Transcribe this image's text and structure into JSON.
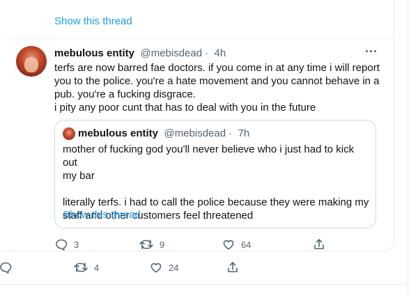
{
  "top_thread_link": "Show this thread",
  "tweet": {
    "name": "mebulous entity",
    "handle": "@mebisdead",
    "dot": "·",
    "time": "4h",
    "text": "terfs are now barred fae doctors. if you come in at any time i will report\nyou to the police. you're a hate movement and you cannot behave in a\npub. you're a fucking disgrace.\ni pity any poor cunt that has to deal with you in the future",
    "actions": {
      "reply_count": "3",
      "retweet_count": "9",
      "like_count": "64"
    }
  },
  "quoted_tweet": {
    "name": "mebulous entity",
    "handle": "@mebisdead",
    "dot": "·",
    "time": "7h",
    "text": "mother of fucking god you'll never believe who i just had to kick out\nmy bar\n\nliterally terfs. i had to call the police because they were making my\nstaff and other customers feel threatened",
    "show_thread": "Show this thread"
  },
  "outer_actions": {
    "retweet_count": "4",
    "like_count": "24"
  },
  "icons": {
    "reply": "reply-icon",
    "retweet": "retweet-icon",
    "like": "heart-icon",
    "share": "share-icon",
    "more": "more-icon"
  },
  "colors": {
    "link": "#1d9bf0",
    "text": "#0f1419",
    "secondary": "#536471",
    "border": "#cfd9de"
  }
}
